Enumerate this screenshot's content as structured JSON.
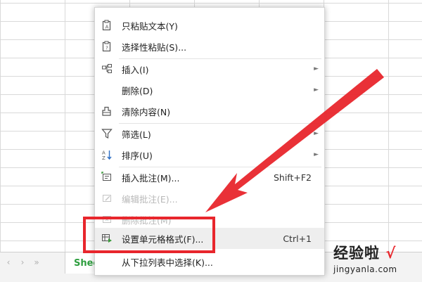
{
  "sheet_tab": {
    "label": "Shee"
  },
  "nav_arrows": [
    "‹",
    "›",
    "»"
  ],
  "context_menu": {
    "items": [
      {
        "label": "只粘贴文本(Y)",
        "icon": "paste-text-icon"
      },
      {
        "label": "选择性粘贴(S)...",
        "icon": "paste-special-icon"
      },
      {
        "label": "插入(I)",
        "icon": "insert-icon",
        "submenu": true
      },
      {
        "label": "删除(D)",
        "icon": "",
        "submenu": true
      },
      {
        "label": "清除内容(N)",
        "icon": "clear-content-icon"
      },
      {
        "label": "筛选(L)",
        "icon": "filter-icon",
        "submenu": true
      },
      {
        "label": "排序(U)",
        "icon": "sort-icon",
        "submenu": true
      },
      {
        "label": "插入批注(M)...",
        "icon": "insert-comment-icon",
        "shortcut": "Shift+F2"
      },
      {
        "label": "编辑批注(E)...",
        "icon": "edit-comment-icon",
        "disabled": true
      },
      {
        "label": "删除批注(M)",
        "icon": "delete-comment-icon",
        "disabled": true
      },
      {
        "label": "设置单元格格式(F)...",
        "icon": "format-cells-icon",
        "shortcut": "Ctrl+1",
        "highlighted": true
      },
      {
        "label": "从下拉列表中选择(K)...",
        "icon": ""
      }
    ]
  },
  "watermark": {
    "top": "经验啦",
    "check": "√",
    "bottom": "jingyanla.com"
  },
  "colors": {
    "annotation_red": "#e8262c",
    "sheet_tab_green": "#2e9e3f"
  }
}
